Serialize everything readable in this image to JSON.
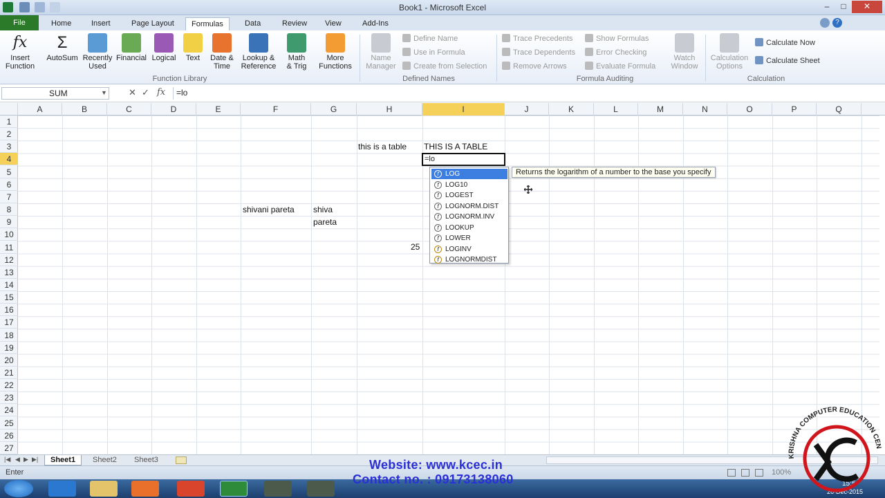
{
  "window": {
    "title": "Book1 - Microsoft Excel"
  },
  "ribbon_tabs": [
    "File",
    "Home",
    "Insert",
    "Page Layout",
    "Formulas",
    "Data",
    "Review",
    "View",
    "Add-Ins"
  ],
  "function_library": {
    "insert_function": "Insert\nFunction",
    "autosum": "AutoSum",
    "recently_used": "Recently\nUsed",
    "financial": "Financial",
    "logical": "Logical",
    "text": "Text",
    "date_time": "Date &\nTime",
    "lookup": "Lookup &\nReference",
    "math": "Math\n& Trig",
    "more": "More\nFunctions",
    "label": "Function Library"
  },
  "defined_names": {
    "name_manager": "Name\nManager",
    "define_name": "Define Name",
    "use_in_formula": "Use in Formula",
    "create_from_selection": "Create from Selection",
    "label": "Defined Names"
  },
  "formula_auditing": {
    "trace_precedents": "Trace Precedents",
    "trace_dependents": "Trace Dependents",
    "remove_arrows": "Remove Arrows",
    "show_formulas": "Show Formulas",
    "error_checking": "Error Checking",
    "evaluate_formula": "Evaluate Formula",
    "watch_window": "Watch\nWindow",
    "label": "Formula Auditing"
  },
  "calculation": {
    "options": "Calculation\nOptions",
    "calc_now": "Calculate Now",
    "calc_sheet": "Calculate Sheet",
    "label": "Calculation"
  },
  "formula_bar": {
    "name_box": "SUM",
    "formula": "=lo"
  },
  "columns": [
    "A",
    "B",
    "C",
    "D",
    "E",
    "F",
    "G",
    "H",
    "I",
    "J",
    "K",
    "L",
    "M",
    "N",
    "O",
    "P",
    "Q"
  ],
  "rows": [
    "1",
    "2",
    "3",
    "4",
    "5",
    "6",
    "7",
    "8",
    "9",
    "10",
    "11",
    "12",
    "13",
    "14",
    "15",
    "16",
    "17",
    "18",
    "19",
    "20",
    "21",
    "22",
    "23",
    "24",
    "25",
    "26",
    "27"
  ],
  "cells": {
    "H3": "this is a table",
    "I3": "THIS IS A TABLE",
    "F8": "shivani pareta",
    "G8": "shiva",
    "G9": "pareta",
    "H11": "25",
    "I4": "=lo"
  },
  "autocomplete": [
    "LOG",
    "LOG10",
    "LOGEST",
    "LOGNORM.DIST",
    "LOGNORM.INV",
    "LOOKUP",
    "LOWER",
    "LOGINV",
    "LOGNORMDIST"
  ],
  "tooltip": "Returns the logarithm of a number to the base you specify",
  "sheets": [
    "Sheet1",
    "Sheet2",
    "Sheet3"
  ],
  "status": {
    "mode": "Enter",
    "zoom": "100%"
  },
  "overlay": {
    "website": "Website: www.kcec.in",
    "contact": "Contact no. : 09173138060",
    "logo_text": "KRISHNA COMPUTER EDUCATION CENTER",
    "clock_time": "15:5",
    "clock_date": "26-Dec-2015"
  },
  "colors": {
    "selected_header": "#f5d15a",
    "file_tab": "#2a7a2a",
    "watermark": "#2b2fd6",
    "logo": "#d0161c"
  }
}
